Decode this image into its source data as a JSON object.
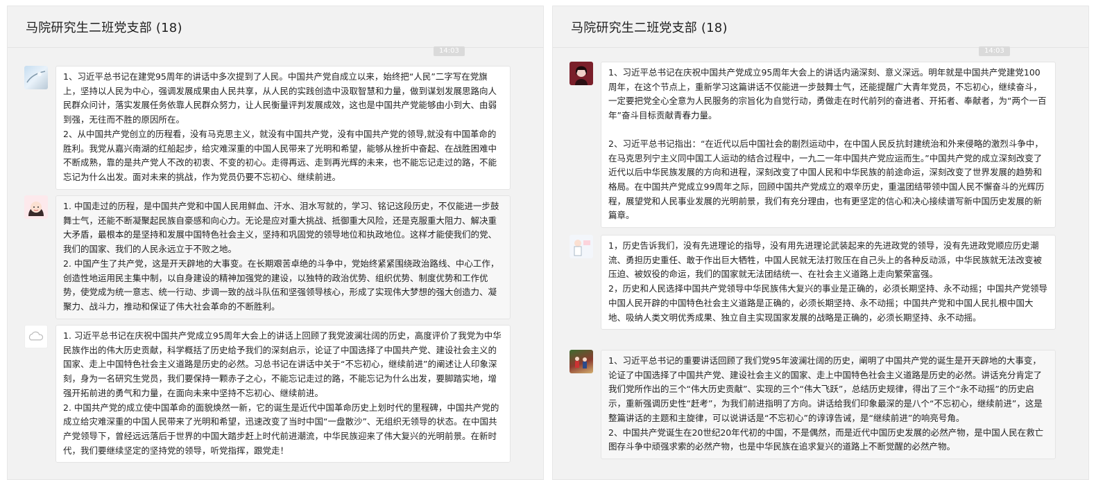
{
  "panels": [
    {
      "title": "马院研究生二班党支部 (18)",
      "time": "14:03",
      "messages": [
        {
          "avatar": "sky-photo-icon",
          "paragraphs": [
            "1、习近平总书记在建党95周年的讲话中多次提到了人民。中国共产党自成立以来，始终把“人民”二字写在党旗上，坚持以人民为中心，强调发展成果由人民共享，从人民的实践创造中汲取智慧和力量，做到谋划发展思路向人民群众问计，落实发展任务依靠人民群众努力，让人民衡量评判发展成效，这也是中国共产党能够由小到大、由弱到强，无往而不胜的原因所在。",
            "2、从中国共产党创立的历程看，没有马克思主义，就没有中国共产党，没有中国共产党的领导,就没有中国革命的胜利。我党从嘉兴南湖的红船起步，给灾难深重的中国人民带来了光明和希望，能够从挫折中奋起、在战胜困难中不断成熟，靠的是共产党人不改的初衷、不变的初心。走得再远、走到再光辉的未来，也不能忘记走过的路，不能忘记为什么出发。面对未来的挑战，作为党员仍要不忘初心、继续前进。"
          ]
        },
        {
          "avatar": "cartoon-girl-icon",
          "paragraphs": [
            "1. 中国走过的历程，是中国共产党和中国人民用鲜血、汗水、泪水写就的，学习、铭记这段历史，不仅能进一步鼓舞士气，还能不断凝聚起民族自豪感和向心力。无论是应对重大挑战、抵御重大风险，还是克服重大阻力、解决重大矛盾，最根本的是坚持和发展中国特色社会主义，坚持和巩固党的领导地位和执政地位。这样才能使我们的党、我们的国家、我们的人民永远立于不败之地。",
            "2. 中国产生了共产党，这是开天辟地的大事变。在长期艰苦卓绝的斗争中，党始终紧紧围绕政治路线、中心工作，创造性地运用民主集中制，以自身建设的精神加强党的建设，以独特的政治优势、组织优势、制度优势和工作优势，使党成为统一意志、统一行动、步调一致的战斗队伍和坚强领导核心，形成了实现伟大梦想的强大创造力、凝聚力、战斗力，推动和保证了伟大社会革命的不断胜利。"
          ]
        },
        {
          "avatar": "cloud-icon",
          "paragraphs": [
            "1. 习近平总书记在庆祝中国共产党成立95周年大会上的讲话上回顾了我党波澜壮阔的历史，高度评价了我党为中华民族作出的伟大历史贡献，科学概括了历史给予我们的深刻启示，论证了中国选择了中国共产党、建设社会主义的国家、走上中国特色社会主义道路是历史的必然。习总书记在讲话中关于“不忘初心，继续前进”的阐述让人印象深刻，身为一名研究生党员，我们要保持一颗赤子之心，不能忘记走过的路，不能忘记为什么出发，要脚踏实地，增强开拓前进的勇气和力量，在面向未来中坚持不忘初心、继续前进。",
            "2. 中国共产党的成立使中国革命的面貌焕然一新，它的诞生是近代中国革命历史上划时代的里程碑，中国共产党的成立给灾难深重的中国人民带来了光明和希望，迅速改变了当时中国“一盘散沙”、无组织无领导的状态。在中国共产党领导下，曾经远远落后于世界的中国大踏步赶上时代前进潮流，中华民族迎来了伟大复兴的光明前景。在新时代，我们要继续坚定的坚持党的领导，听党指挥，跟党走！"
          ]
        }
      ]
    },
    {
      "title": "马院研究生二班党支部 (18)",
      "time": "14:03",
      "messages": [
        {
          "avatar": "dark-portrait-icon",
          "paragraphs": [
            "1、习近平总书记在庆祝中国共产党成立95周年大会上的讲话内涵深刻、意义深远。明年就是中国共产党建党100周年，在这个节点上，重新学习这篇讲话不仅能进一步鼓舞士气，还能提醒广大青年党员，不忘初心，继续奋斗，一定要把党全心全意为人民服务的宗旨化为自觉行动，勇做走在时代前列的奋进者、开拓者、奉献者，为“两个一百年”奋斗目标贡献青春力量。",
            "2、习近平总书记指出：“在近代以后中国社会的剧烈运动中，在中国人民反抗封建统治和外来侵略的激烈斗争中，在马克思列宁主义同中国工人运动的结合过程中，一九二一年中国共产党应运而生。”中国共产党的成立深刻改变了近代以后中华民族发展的方向和进程，深刻改变了中国人民和中华民族的前途命运，深刻改变了世界发展的趋势和格局。在中国共产党成立99周年之际，回顾中国共产党成立的艰辛历史，重温团结带领中国人民不懈奋斗的光辉历程，展望党和人民事业发展的光明前景，我们有充分理由，也有更坚定的信心和决心接续谱写新中国历史发展的新篇章。"
          ]
        },
        {
          "avatar": "doctor-cartoon-icon",
          "paragraphs": [
            "1，历史告诉我们，没有先进理论的指导，没有用先进理论武装起来的先进政党的领导，没有先进政党顺应历史潮流、勇担历史重任、敢于作出巨大牺牲，中国人民就无法打败压在自己头上的各种反动派，中华民族就无法改变被压迫、被奴役的命运，我们的国家就无法团结统一、在社会主义道路上走向繁荣富强。",
            "2，历史和人民选择中国共产党领导中华民族伟大复兴的事业是正确的，必须长期坚持、永不动摇；中国共产党领导中国人民开辟的中国特色社会主义道路是正确的，必须长期坚持、永不动摇；中国共产党和中国人民扎根中国大地、吸纳人类文明优秀成果、独立自主实现国家发展的战略是正确的，必须长期坚持、永不动摇。"
          ]
        },
        {
          "avatar": "field-photo-icon",
          "paragraphs": [
            "1、习近平总书记的重要讲话回顾了我们党95年波澜壮阔的历史，阐明了中国共产党的诞生是开天辟地的大事变，论证了中国选择了中国共产党、建设社会主义的国家、走上中国特色社会主义道路是历史的必然。讲话充分肯定了我们党所作出的三个“伟大历史贡献”、实现的三个“伟大飞跃”，总结历史规律，得出了三个“永不动摇”的历史启示，重新强调历史性“赶考”，为我们前进指明了方向。讲话给我们印象最深的是八个“不忘初心，继续前进”，这是整篇讲话的主题和主旋律，可以说讲话是“不忘初心”的谆谆告诫，是“继续前进”的响亮号角。",
            "2、中国共产党诞生在20世纪20年代初的中国，不是偶然，而是近代中国历史发展的必然产物，是中国人民在救亡图存斗争中顽强求索的必然产物，也是中华民族在追求复兴的道路上不断觉醒的必然产物。"
          ]
        }
      ]
    }
  ],
  "colors": {
    "panel_bg": "#f2f2f2",
    "bubble_bg": "#ffffff",
    "text": "#222222"
  }
}
